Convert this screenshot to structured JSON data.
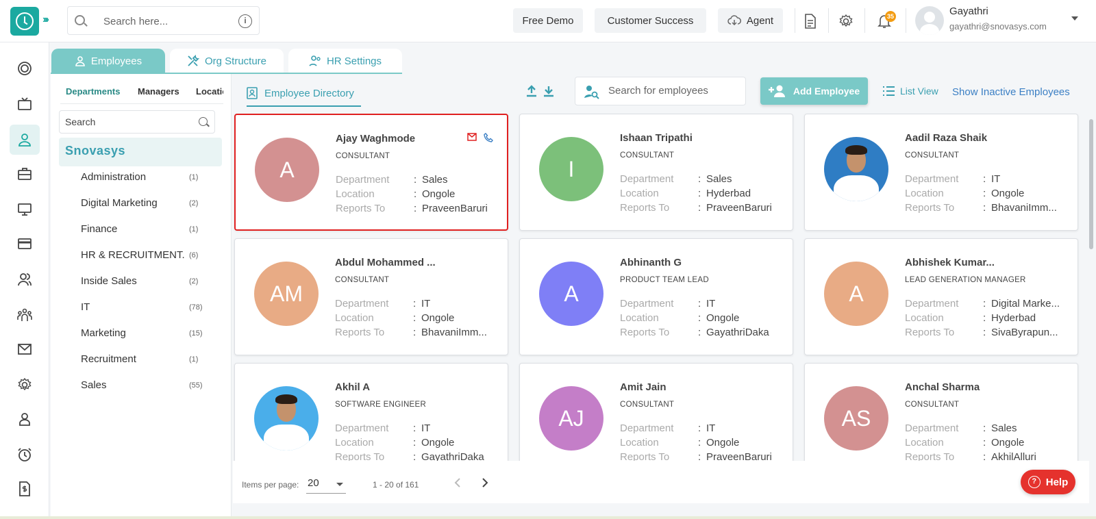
{
  "topbar": {
    "search_placeholder": "Search here...",
    "free_demo": "Free Demo",
    "customer_success": "Customer Success",
    "agent": "Agent",
    "notification_count": "35",
    "user_name": "Gayathri",
    "user_email": "gayathri@snovasys.com"
  },
  "tabs": {
    "employees": "Employees",
    "org_structure": "Org Structure",
    "hr_settings": "HR Settings"
  },
  "left_panel": {
    "subtabs": [
      "Departments",
      "Managers",
      "Locations"
    ],
    "search_placeholder": "Search",
    "org_name": "Snovasys",
    "departments": [
      {
        "name": "Administration",
        "count": "(1)"
      },
      {
        "name": "Digital Marketing",
        "count": "(2)"
      },
      {
        "name": "Finance",
        "count": "(1)"
      },
      {
        "name": "HR & RECRUITMENT.",
        "count": "(6)"
      },
      {
        "name": "Inside Sales",
        "count": "(2)"
      },
      {
        "name": "IT",
        "count": "(78)"
      },
      {
        "name": "Marketing",
        "count": "(15)"
      },
      {
        "name": "Recruitment",
        "count": "(1)"
      },
      {
        "name": "Sales",
        "count": "(55)"
      }
    ]
  },
  "directory": {
    "tab_label": "Employee Directory",
    "search_placeholder": "Search for employees",
    "add_employee": "Add Employee",
    "list_view": "List View",
    "show_inactive": "Show Inactive Employees"
  },
  "field_labels": {
    "department": "Department",
    "location": "Location",
    "reports_to": "Reports To",
    "colon": ":"
  },
  "employees": [
    {
      "name": "Ajay Waghmode",
      "role": "CONSULTANT",
      "initials": "A",
      "color": "#d39191",
      "department": "Sales",
      "location": "Ongole",
      "reports_to": "PraveenBaruri"
    },
    {
      "name": "Ishaan Tripathi",
      "role": "CONSULTANT",
      "initials": "I",
      "color": "#7cc07a",
      "department": "Sales",
      "location": "Hyderbad",
      "reports_to": "PraveenBaruri"
    },
    {
      "name": "Aadil Raza Shaik",
      "role": "CONSULTANT",
      "initials": "",
      "color": "#3d8ed0",
      "department": "IT",
      "location": "Ongole",
      "reports_to": "BhavaniImm..."
    },
    {
      "name": "Abdul Mohammed ...",
      "role": "CONSULTANT",
      "initials": "AM",
      "color": "#e8ab85",
      "department": "IT",
      "location": "Ongole",
      "reports_to": "BhavaniImm..."
    },
    {
      "name": "Abhinanth G",
      "role": "PRODUCT TEAM LEAD",
      "initials": "A",
      "color": "#7f7ff6",
      "department": "IT",
      "location": "Ongole",
      "reports_to": "GayathriDaka"
    },
    {
      "name": "Abhishek Kumar...",
      "role": "LEAD GENERATION MANAGER",
      "initials": "A",
      "color": "#e8ab85",
      "department": "Digital Marke...",
      "location": "Hyderbad",
      "reports_to": "SivaByrapun..."
    },
    {
      "name": "Akhil A",
      "role": "SOFTWARE ENGINEER",
      "initials": "",
      "color": "#4aaeea",
      "department": "IT",
      "location": "Ongole",
      "reports_to": "GayathriDaka"
    },
    {
      "name": "Amit Jain",
      "role": "CONSULTANT",
      "initials": "AJ",
      "color": "#c47ec8",
      "department": "IT",
      "location": "Ongole",
      "reports_to": "PraveenBaruri"
    },
    {
      "name": "Anchal Sharma",
      "role": "CONSULTANT",
      "initials": "AS",
      "color": "#d39191",
      "department": "Sales",
      "location": "Ongole",
      "reports_to": "AkhilAlluri"
    }
  ],
  "pagination": {
    "items_per_page_label": "Items per page:",
    "items_per_page": "20",
    "range": "1 - 20 of 161"
  },
  "help": "Help",
  "colors": {
    "accent": "#7ac9c7",
    "link": "#3a9fb0",
    "selected_border": "#e02020",
    "help": "#e5322d"
  }
}
